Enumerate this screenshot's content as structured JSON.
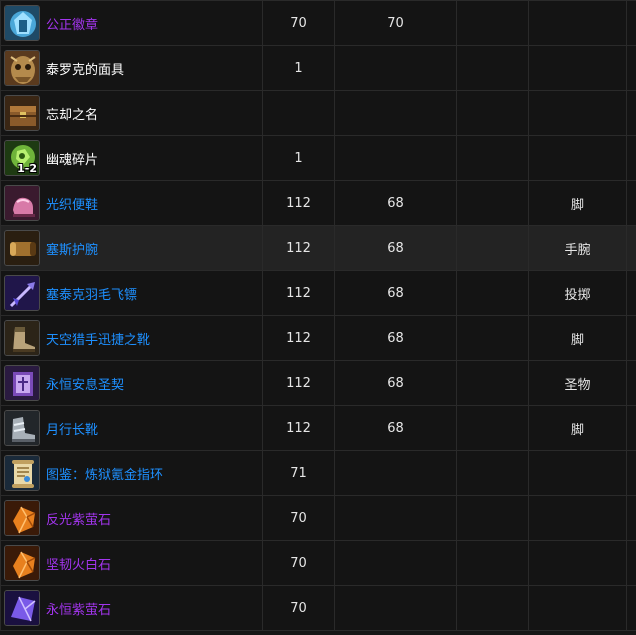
{
  "colors": {
    "epic": "#a335ee",
    "rare": "#1e90ff",
    "common": "#ffffff"
  },
  "rows": [
    {
      "name": "公正徽章",
      "quality": "epic",
      "icon": "badge-of-justice-icon",
      "level": "70",
      "req": "70",
      "slot": "",
      "badge": ""
    },
    {
      "name": "泰罗克的面具",
      "quality": "common",
      "icon": "terokk-mask-icon",
      "level": "1",
      "req": "",
      "slot": "",
      "badge": ""
    },
    {
      "name": "忘却之名",
      "quality": "common",
      "icon": "forgotten-names-chest-icon",
      "level": "",
      "req": "",
      "slot": "",
      "badge": ""
    },
    {
      "name": "幽魂碎片",
      "quality": "common",
      "icon": "spirit-shard-icon",
      "level": "1",
      "req": "",
      "slot": "",
      "badge": "1-2"
    },
    {
      "name": "光织便鞋",
      "quality": "rare",
      "icon": "slippers-icon",
      "level": "112",
      "req": "68",
      "slot": "脚",
      "badge": ""
    },
    {
      "name": "塞斯护腕",
      "quality": "rare",
      "icon": "bracer-icon",
      "level": "112",
      "req": "68",
      "slot": "手腕",
      "badge": ""
    },
    {
      "name": "塞泰克羽毛飞镖",
      "quality": "rare",
      "icon": "feather-dart-icon",
      "level": "112",
      "req": "68",
      "slot": "投掷",
      "badge": ""
    },
    {
      "name": "天空猎手迅捷之靴",
      "quality": "rare",
      "icon": "boots-icon",
      "level": "112",
      "req": "68",
      "slot": "脚",
      "badge": ""
    },
    {
      "name": "永恒安息圣契",
      "quality": "rare",
      "icon": "libram-icon",
      "level": "112",
      "req": "68",
      "slot": "圣物",
      "badge": ""
    },
    {
      "name": "月行长靴",
      "quality": "rare",
      "icon": "moonwalker-boots-icon",
      "level": "112",
      "req": "68",
      "slot": "脚",
      "badge": ""
    },
    {
      "name": "图鉴：炼狱氪金指环",
      "quality": "rare",
      "icon": "recipe-scroll-icon",
      "level": "71",
      "req": "",
      "slot": "",
      "badge": ""
    },
    {
      "name": "反光紫萤石",
      "quality": "epic",
      "icon": "orange-gem-icon",
      "level": "70",
      "req": "",
      "slot": "",
      "badge": ""
    },
    {
      "name": "坚韧火白石",
      "quality": "epic",
      "icon": "orange-gem-icon",
      "level": "70",
      "req": "",
      "slot": "",
      "badge": ""
    },
    {
      "name": "永恒紫萤石",
      "quality": "epic",
      "icon": "purple-gem-icon",
      "level": "70",
      "req": "",
      "slot": "",
      "badge": ""
    }
  ]
}
